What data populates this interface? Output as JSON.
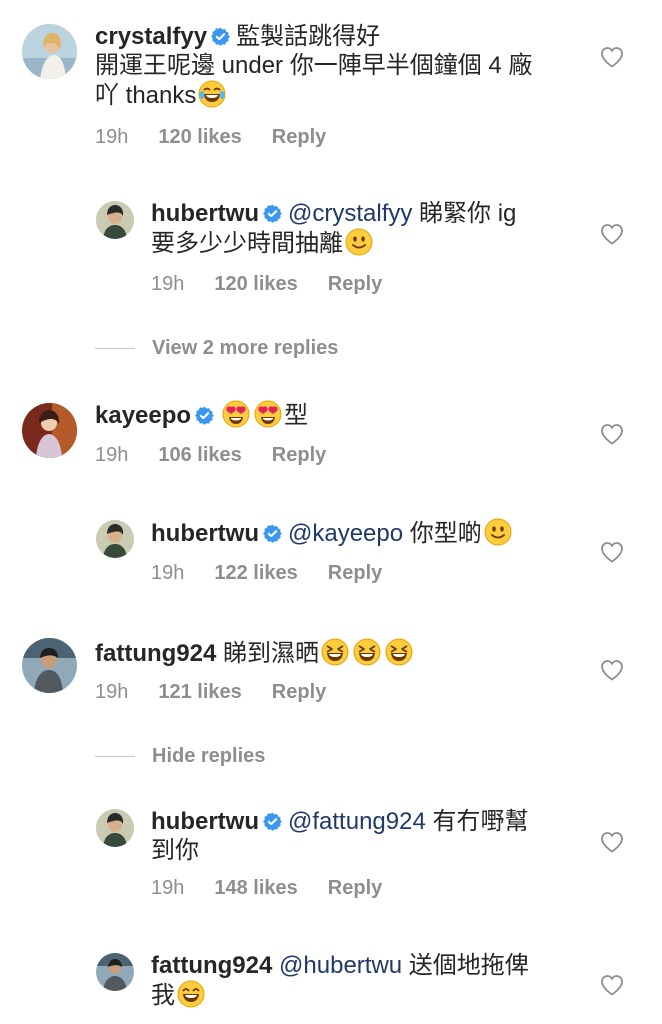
{
  "comments": [
    {
      "username": "crystalfyy",
      "lines": [
        "監製話跳得好",
        "開運王呢邊 under 你一陣早半個鐘個 4 廠",
        "吖 thanks"
      ],
      "time": "19h",
      "likes": "120 likes",
      "reply": "Reply"
    },
    {
      "username": "hubertwu",
      "mention": "@crystalfyy",
      "lines": [
        "睇緊你 ig",
        "要多少少時間抽離"
      ],
      "time": "19h",
      "likes": "120 likes",
      "reply": "Reply"
    },
    {
      "username": "kayeepo",
      "text_tail": "型",
      "time": "19h",
      "likes": "106 likes",
      "reply": "Reply"
    },
    {
      "username": "hubertwu",
      "mention": "@kayeepo",
      "text": "你型啲",
      "time": "19h",
      "likes": "122 likes",
      "reply": "Reply"
    },
    {
      "username": "fattung924",
      "text": "睇到濕晒",
      "time": "19h",
      "likes": "121 likes",
      "reply": "Reply"
    },
    {
      "username": "hubertwu",
      "mention": "@fattung924",
      "lines": [
        "有冇嘢幫",
        "到你"
      ],
      "time": "19h",
      "likes": "148 likes",
      "reply": "Reply"
    },
    {
      "username": "fattung924",
      "mention": "@hubertwu",
      "lines": [
        "送個地拖俾",
        "我"
      ]
    }
  ],
  "view_more": "View 2 more replies",
  "hide_replies": "Hide replies",
  "icons": {
    "verified": "verified-badge-icon",
    "heart": "heart-outline-icon",
    "emoji_laugh": "tears-of-joy-emoji",
    "emoji_smile": "slight-smile-emoji",
    "emoji_hearteyes": "heart-eyes-emoji",
    "emoji_grin": "grinning-squint-emoji",
    "emoji_beam": "beaming-emoji"
  },
  "colors": {
    "mention": "#1f3a68",
    "meta": "#8e8e8e",
    "verified": "#3897f0"
  }
}
